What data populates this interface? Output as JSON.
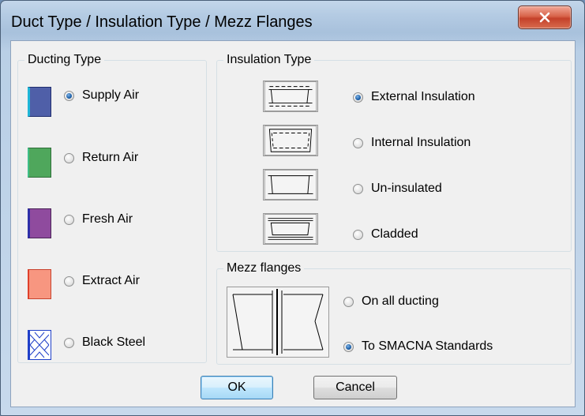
{
  "window": {
    "title": "Duct Type / Insulation Type / Mezz Flanges"
  },
  "ducting": {
    "label": "Ducting Type",
    "items": [
      {
        "label": "Supply Air",
        "color": "#4f5fa8",
        "checked": true
      },
      {
        "label": "Return Air",
        "color": "#4fa75c",
        "checked": false
      },
      {
        "label": "Fresh Air",
        "color": "#8f4b9e",
        "checked": false
      },
      {
        "label": "Extract Air",
        "color": "#f79680",
        "checked": false
      },
      {
        "label": "Black Steel",
        "color": "#1f3fc8",
        "checked": false
      }
    ]
  },
  "insulation": {
    "label": "Insulation Type",
    "items": [
      {
        "label": "External Insulation",
        "checked": true
      },
      {
        "label": "Internal Insulation",
        "checked": false
      },
      {
        "label": "Un-insulated",
        "checked": false
      },
      {
        "label": "Cladded",
        "checked": false
      }
    ]
  },
  "mezz": {
    "label": "Mezz flanges",
    "items": [
      {
        "label": "On all ducting",
        "checked": false
      },
      {
        "label": "To SMACNA Standards",
        "checked": true
      }
    ]
  },
  "buttons": {
    "ok": "OK",
    "cancel": "Cancel"
  }
}
